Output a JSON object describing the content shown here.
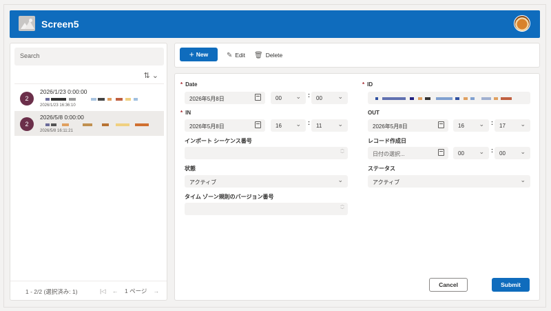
{
  "app": {
    "title": "Screen5"
  },
  "list": {
    "search_placeholder": "Search",
    "sort_icon": "sort-icon",
    "items": [
      {
        "badge": "2",
        "title": "2026/1/23 0:00:00",
        "subtitle": "2026/1/23 16:36:10",
        "selected": false
      },
      {
        "badge": "2",
        "title": "2026/5/8 0:00:00",
        "subtitle": "2026/5/8 16:11:21",
        "selected": true
      }
    ],
    "pager": {
      "count": "1 - 2/2 (選択済み: 1)",
      "page": "1 ページ"
    }
  },
  "toolbar": {
    "new_label": "New",
    "edit_label": "Edit",
    "delete_label": "Delete"
  },
  "form": {
    "date": {
      "label": "Date",
      "value": "2026年5月8日",
      "hour": "00",
      "minute": "00"
    },
    "id": {
      "label": "ID"
    },
    "in": {
      "label": "IN",
      "value": "2026年5月8日",
      "hour": "16",
      "minute": "11"
    },
    "out": {
      "label": "OUT",
      "value": "2026年5月8日",
      "hour": "16",
      "minute": "17"
    },
    "import_seq": {
      "label": "インポート シーケンス番号"
    },
    "record_created": {
      "label": "レコード作成日",
      "placeholder": "日付の選択...",
      "hour": "00",
      "minute": "00"
    },
    "state": {
      "label": "状態",
      "value": "アクティブ"
    },
    "status": {
      "label": "ステータス",
      "value": "アクティブ"
    },
    "tz_version": {
      "label": "タイム ゾーン規則のバージョン番号"
    },
    "cancel_label": "Cancel",
    "submit_label": "Submit"
  },
  "colors": {
    "accent": "#0f6cbd",
    "badge": "#6b2f4a",
    "required": "#a4262c"
  }
}
